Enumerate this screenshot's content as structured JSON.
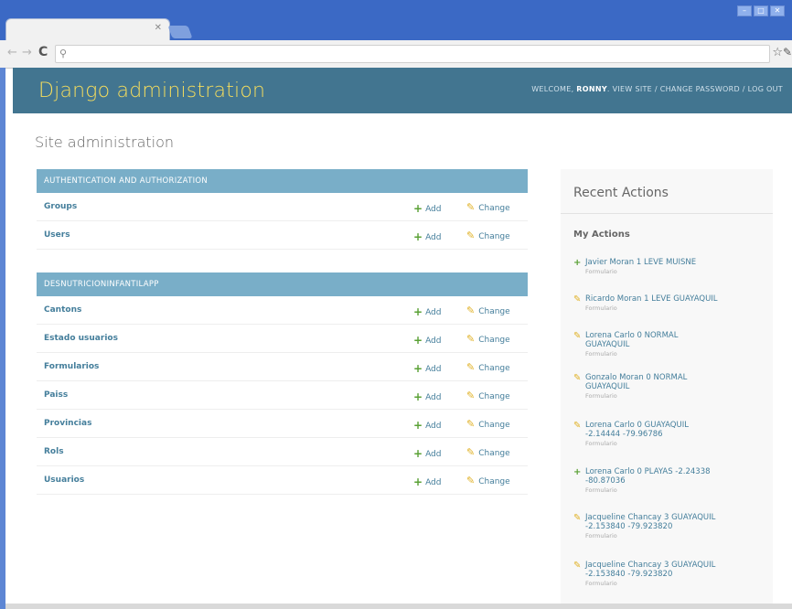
{
  "header": {
    "branding": "Django administration",
    "welcome": "WELCOME,",
    "username": "RONNY",
    "view_site": "VIEW SITE",
    "change_password": "CHANGE PASSWORD",
    "log_out": "LOG OUT",
    "separator": "/",
    "background_color": "#427590",
    "branding_color": "#f5dd5d"
  },
  "page_title": "Site administration",
  "modules": [
    {
      "caption": "AUTHENTICATION AND AUTHORIZATION",
      "rows": [
        {
          "name": "Groups",
          "add": "Add",
          "change": "Change"
        },
        {
          "name": "Users",
          "add": "Add",
          "change": "Change"
        }
      ]
    },
    {
      "caption": "DESNUTRICIONINFANTILAPP",
      "rows": [
        {
          "name": "Cantons",
          "add": "Add",
          "change": "Change"
        },
        {
          "name": "Estado usuarios",
          "add": "Add",
          "change": "Change"
        },
        {
          "name": "Formularios",
          "add": "Add",
          "change": "Change"
        },
        {
          "name": "Paiss",
          "add": "Add",
          "change": "Change"
        },
        {
          "name": "Provincias",
          "add": "Add",
          "change": "Change"
        },
        {
          "name": "Rols",
          "add": "Add",
          "change": "Change"
        },
        {
          "name": "Usuarios",
          "add": "Add",
          "change": "Change"
        }
      ]
    }
  ],
  "recent": {
    "title": "Recent Actions",
    "subtitle": "My Actions",
    "items": [
      {
        "type": "add",
        "lines": [
          "Javier Moran 1 LEVE MUISNE"
        ],
        "model": "Formulario"
      },
      {
        "type": "change",
        "lines": [
          "Ricardo Moran 1 LEVE GUAYAQUIL"
        ],
        "model": "Formulario"
      },
      {
        "type": "change",
        "lines": [
          "Lorena Carlo 0 NORMAL",
          "GUAYAQUIL"
        ],
        "model": "Formulario"
      },
      {
        "type": "change",
        "lines": [
          "Gonzalo Moran 0 NORMAL",
          "GUAYAQUIL"
        ],
        "model": "Formulario"
      },
      {
        "type": "change",
        "lines": [
          "Lorena Carlo 0 GUAYAQUIL",
          "-2.14444 -79.96786"
        ],
        "model": "Formulario"
      },
      {
        "type": "add",
        "lines": [
          "Lorena Carlo 0 PLAYAS -2.24338",
          "-80.87036"
        ],
        "model": "Formulario"
      },
      {
        "type": "change",
        "lines": [
          "Jacqueline Chancay 3 GUAYAQUIL",
          "-2.153840 -79.923820"
        ],
        "model": "Formulario"
      },
      {
        "type": "change",
        "lines": [
          "Jacqueline Chancay 3 GUAYAQUIL",
          "-2.153840 -79.923820"
        ],
        "model": "Formulario"
      }
    ]
  },
  "icons": {
    "back": "back-arrow-icon",
    "forward": "forward-arrow-icon",
    "reload": "reload-icon",
    "search": "search-icon",
    "bookmark": "star-icon",
    "settings": "wrench-icon",
    "add": "plus-icon",
    "change": "pencil-icon"
  }
}
